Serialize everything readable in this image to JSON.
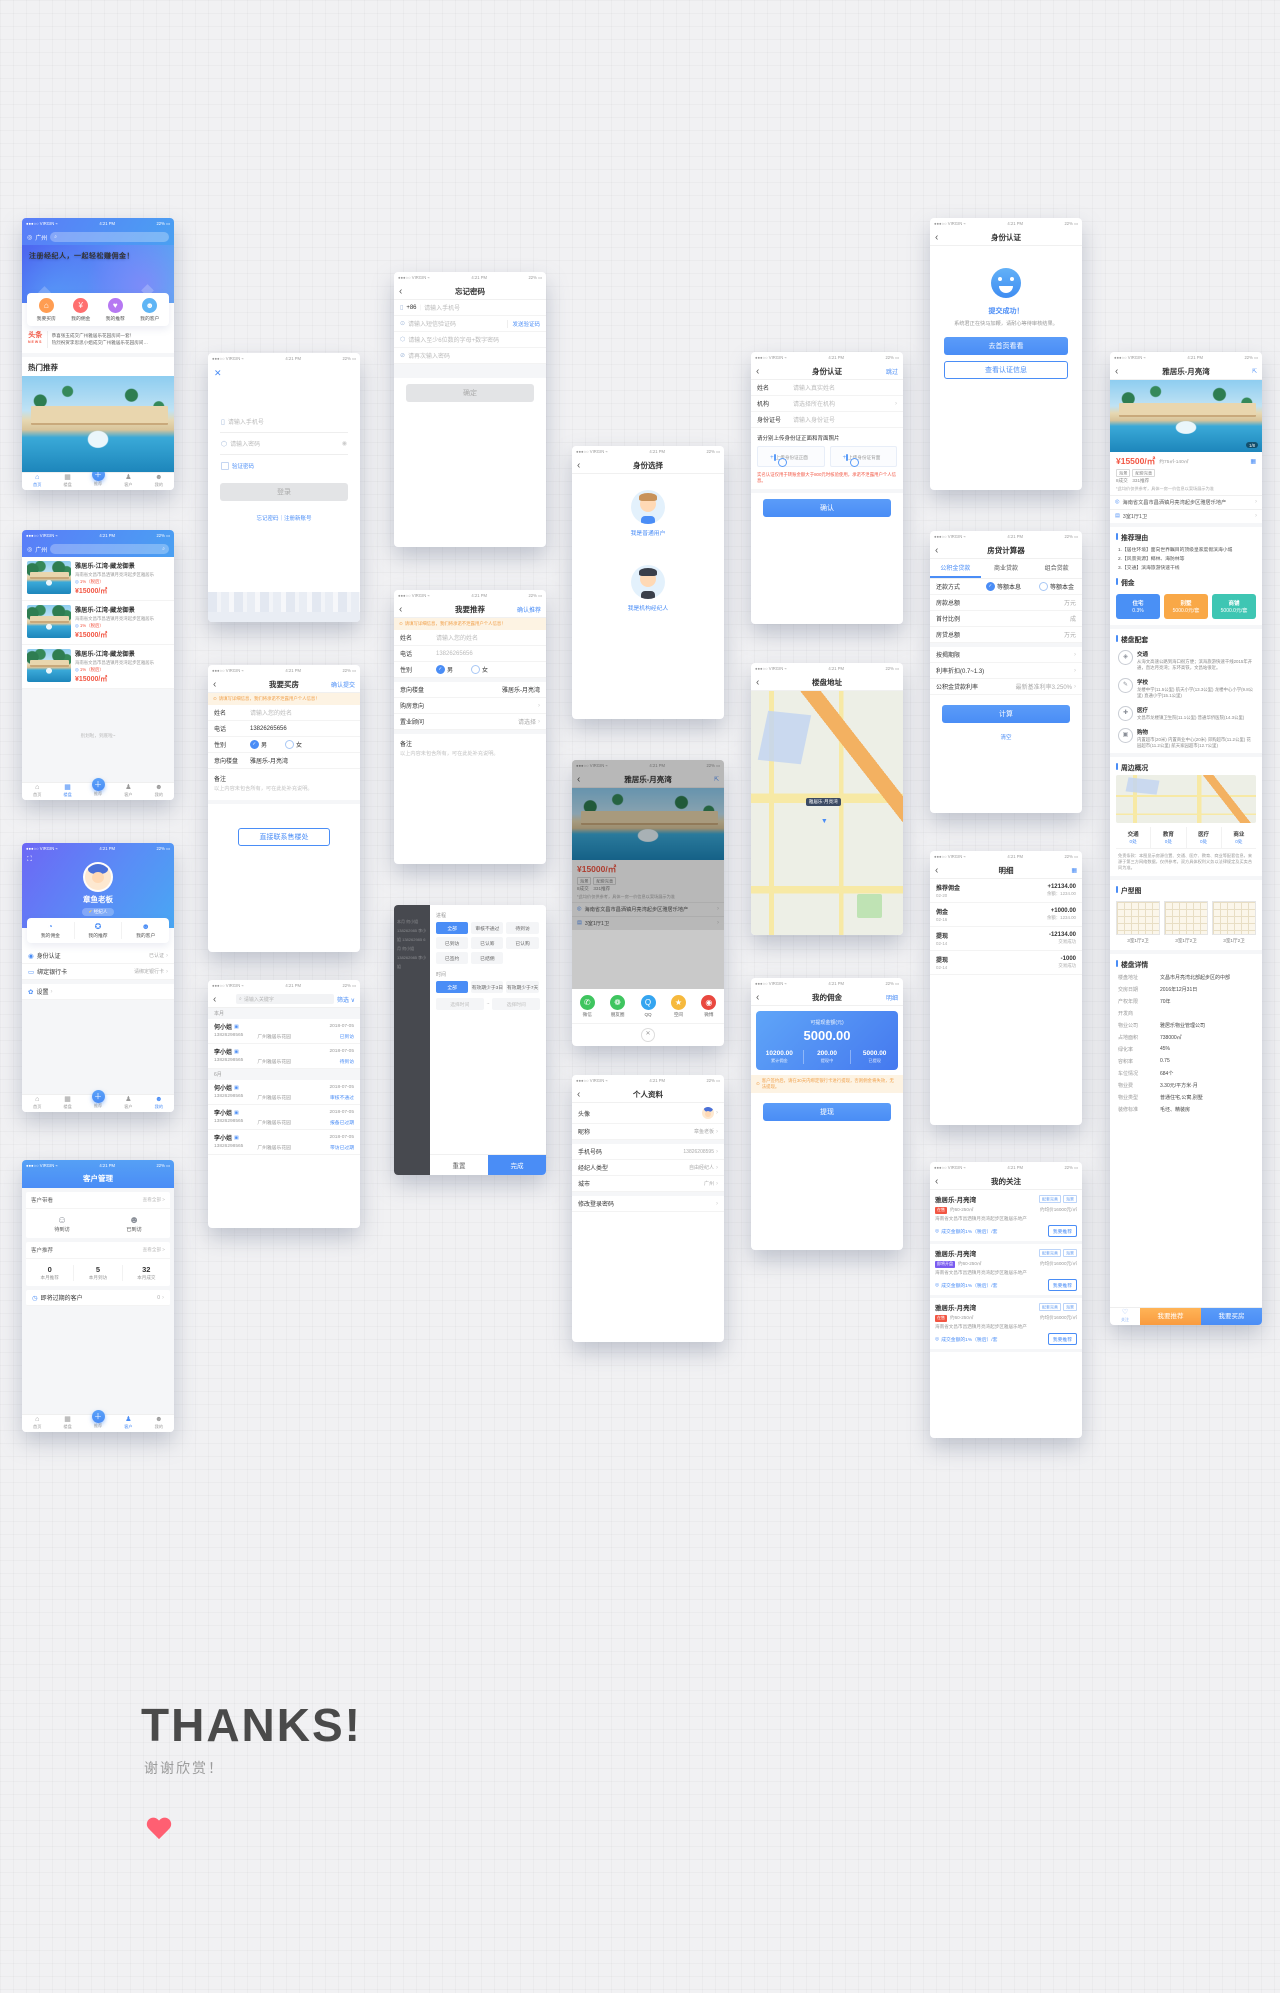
{
  "c": {
    "carrier": "●●●○○ VIRGIN ⌁",
    "time": "4:21 PM",
    "battery": "22% ▭"
  },
  "s": {
    "home": {
      "city": "广州",
      "banner": "注册经纪人，一起轻松赚佣金！",
      "cats": [
        {
          "label": "我要买房",
          "icon": "⌂",
          "color": "#ff9d52"
        },
        {
          "label": "我的佣金",
          "icon": "¥",
          "color": "#ff6f6f"
        },
        {
          "label": "我的推荐",
          "icon": "♥",
          "color": "#b678f2"
        },
        {
          "label": "我的客户",
          "icon": "☻",
          "color": "#5fb5f5"
        }
      ],
      "news_tag": "头条",
      "news_tag_en": "NEWS",
      "news": [
        "恭喜张玉成交广州雅居乐花园房间一套！",
        "热烈祝贺李思思小姐成交广州雅居乐花园房间…"
      ],
      "hot_title": "热门推荐",
      "tabs": [
        {
          "label": "首页",
          "icon": "⌂",
          "cls": "on"
        },
        {
          "label": "楼盘",
          "icon": "▦"
        },
        {
          "label": "推荐",
          "icon": "＋",
          "cls": "plus"
        },
        {
          "label": "客户",
          "icon": "♟"
        },
        {
          "label": "我的",
          "icon": "☻"
        }
      ]
    },
    "listings": {
      "city": "广州",
      "items": [
        {
          "title": "雅居乐-江湾-藏龙御景",
          "addr": "海南省文昌市昌洒镇月亮湾起步区雅居乐",
          "comm": "1%（税后）",
          "price": "¥15000/㎡"
        },
        {
          "title": "雅居乐-江湾-藏龙御景",
          "addr": "海南省文昌市昌洒镇月亮湾起步区雅居乐",
          "comm": "1%（税后）",
          "price": "¥15000/㎡"
        },
        {
          "title": "雅居乐-江湾-藏龙御景",
          "addr": "海南省文昌市昌洒镇月亮湾起步区雅居乐",
          "comm": "1%（税后）",
          "price": "¥15000/㎡"
        }
      ],
      "end": "别划啦，到底啦~",
      "tabs": [
        {
          "label": "首页",
          "icon": "⌂"
        },
        {
          "label": "楼盘",
          "icon": "▦",
          "cls": "on"
        },
        {
          "label": "推荐",
          "icon": "＋",
          "cls": "plus"
        },
        {
          "label": "客户",
          "icon": "♟"
        },
        {
          "label": "我的",
          "icon": "☻"
        }
      ]
    },
    "profile": {
      "name": "章鱼老板",
      "badge_check": "✔",
      "badge": "经纪人",
      "quick": [
        {
          "label": "我的佣金",
          "icon": "◔"
        },
        {
          "label": "我的推荐",
          "icon": "✪"
        },
        {
          "label": "我的客户",
          "icon": "☻"
        }
      ],
      "rows": [
        {
          "icon": "◉",
          "label": "身份认证",
          "value": "已认证"
        },
        {
          "icon": "▭",
          "label": "绑定银行卡",
          "value": "请绑定银行卡"
        }
      ],
      "settings": "设置",
      "settings_icon": "✿",
      "tabs": [
        {
          "label": "首页",
          "icon": "⌂"
        },
        {
          "label": "楼盘",
          "icon": "▦"
        },
        {
          "label": "推荐",
          "icon": "＋",
          "cls": "plus"
        },
        {
          "label": "客户",
          "icon": "♟"
        },
        {
          "label": "我的",
          "icon": "☻",
          "cls": "on"
        }
      ]
    },
    "customers": {
      "title": "客户管理",
      "more": "查看全部 >",
      "sec1": "客户带看",
      "visits": [
        {
          "label": "待到访",
          "icon": "☺"
        },
        {
          "label": "已到访",
          "icon": "☻"
        }
      ],
      "sec2": "客户推荐",
      "stats": [
        {
          "num": "0",
          "label": "本月推荐"
        },
        {
          "num": "5",
          "label": "本月到访"
        },
        {
          "num": "32",
          "label": "本月成交"
        }
      ],
      "expiring": "即将过期的客户",
      "expiring_count": "0",
      "tabs": [
        {
          "label": "首页",
          "icon": "⌂"
        },
        {
          "label": "楼盘",
          "icon": "▦"
        },
        {
          "label": "推荐",
          "icon": "＋",
          "cls": "plus"
        },
        {
          "label": "客户",
          "icon": "♟",
          "cls": "on"
        },
        {
          "label": "我的",
          "icon": "☻"
        }
      ]
    },
    "login": {
      "close": "✕",
      "phone_ph": "请输入手机号",
      "pwd_ph": "请输入密码",
      "remember": "验证密码",
      "submit": "登录",
      "link1": "忘记密码",
      "sep": "｜",
      "link2": "注册新账号"
    },
    "buyForm": {
      "title": "我要买房",
      "action": "确认提交",
      "warning": "请填写详细信息，我们将承诺不泄露用户个人信息！",
      "name_lbl": "姓名",
      "name_ph": "请输入您的姓名",
      "tel_lbl": "电话",
      "tel_val": "13826265656",
      "gender_lbl": "性别",
      "male": "男",
      "female": "女",
      "intent_lbl": "意向楼盘",
      "intent_val": "雅居乐-月亮湾",
      "note_lbl": "备注",
      "note_ph": "以上内容未包含所有，可在此处补充说明。",
      "contact_btn": "直接联系售楼处"
    },
    "clientList": {
      "search_ph": "请输入关键字",
      "filter": "筛选 ∨",
      "groups": [
        {
          "name": "本月",
          "entries": [
            {
              "name": "何小姐",
              "tel": "13826298565",
              "estate": "广州雅居乐花园",
              "date": "2018-07-05",
              "status": "已到访"
            },
            {
              "name": "李小姐",
              "tel": "13826298565",
              "estate": "广州雅居乐花园",
              "date": "2018-07-05",
              "status": "待到访"
            }
          ]
        },
        {
          "name": "6月",
          "entries": [
            {
              "name": "何小姐",
              "tel": "13826298565",
              "estate": "广州雅居乐花园",
              "date": "2018-07-05",
              "status": "审核不通过"
            },
            {
              "name": "李小姐",
              "tel": "13826298565",
              "estate": "广州雅居乐花园",
              "date": "2018-07-05",
              "status": "报备已过期"
            },
            {
              "name": "李小姐",
              "tel": "13826298565",
              "estate": "广州雅居乐花园",
              "date": "2018-07-05",
              "status": "带访已过期"
            }
          ]
        }
      ]
    },
    "forgotPwd": {
      "title": "忘记密码",
      "prefix": "+86",
      "phone_ph": "请输入手机号",
      "sms_ph": "请输入短信验证码",
      "send": "发送验证码",
      "pwd_ph": "请输入至少6位数的字母+数字密码",
      "pwd2_ph": "请再次输入密码",
      "submit": "确定"
    },
    "recommendForm": {
      "title": "我要推荐",
      "action": "确认推荐",
      "warning": "请填写详细信息，我们将承诺不泄露用户个人信息！",
      "name_lbl": "姓名",
      "name_ph": "请输入您的姓名",
      "tel_lbl": "电话",
      "tel_val": "13826265656",
      "gender_lbl": "性别",
      "male": "男",
      "female": "女",
      "intent_lbl": "意向楼盘",
      "intent_val": "雅居乐-月亮湾",
      "buy_lbl": "购房意向",
      "advisor_lbl": "置业顾问",
      "advisor_ph": "请选择",
      "note_lbl": "备注",
      "note_ph": "以上内容未包含所有，可在此处补充说明。"
    },
    "filter": {
      "ghost_lines": "本月  何小姐  138262985  李小姐  138262985  6月  何小姐  138262985  李小姐",
      "sec1": "进程",
      "process": [
        {
          "label": "全部",
          "cls": "sel"
        },
        {
          "label": "审核不通过"
        },
        {
          "label": "待到访"
        },
        {
          "label": "已到访"
        },
        {
          "label": "已认筹"
        },
        {
          "label": "已认购"
        },
        {
          "label": "已签约"
        },
        {
          "label": "已结佣"
        }
      ],
      "sec2": "时间",
      "time": [
        {
          "label": "全部",
          "cls": "sel"
        },
        {
          "label": "有效期少于3日"
        },
        {
          "label": "有效期少于7天"
        }
      ],
      "time_ph1": "选择时间",
      "tilde": "~",
      "time_ph2": "选择时间",
      "reset": "重置",
      "done": "完成"
    },
    "identityChoice": {
      "title": "身份选择",
      "opt1": "我是普通用户",
      "opt2": "我是机构经纪人"
    },
    "share": {
      "title": "雅居乐-月亮湾",
      "price": "¥15000/㎡",
      "tag1": "海景",
      "tag2": "配套完善",
      "deal": "8成交",
      "rec": "331推荐",
      "note": "*此均价仅供参考，具体一房一价信息以案场展示为准",
      "addr": "海南省文昌市昌洒镇月亮湾起步区雅居乐地产",
      "unit": "3室1厅1卫",
      "channels": [
        {
          "label": "微信",
          "icon": "✆",
          "color": "#3fc55f"
        },
        {
          "label": "朋友圈",
          "icon": "❁",
          "color": "#3fc55f"
        },
        {
          "label": "QQ",
          "icon": "Q",
          "color": "#35a5f0"
        },
        {
          "label": "空间",
          "icon": "★",
          "color": "#f6b93d"
        },
        {
          "label": "微博",
          "icon": "◉",
          "color": "#e9483f"
        }
      ]
    },
    "personalInfo": {
      "title": "个人资料",
      "avatar_lbl": "头像",
      "rows1": [
        {
          "label": "昵称",
          "value": "章鱼老板"
        }
      ],
      "rows2": [
        {
          "label": "手机号码",
          "value": "13826208595"
        },
        {
          "label": "经纪人类型",
          "value": "自由经纪人"
        },
        {
          "label": "城市",
          "value": "广州"
        }
      ],
      "rows3": [
        {
          "label": "修改登录密码",
          "value": ""
        }
      ]
    },
    "identityAuth": {
      "title": "身份认证",
      "skip": "跳过",
      "name_lbl": "姓名",
      "name_ph": "请输入真实姓名",
      "org_lbl": "机构",
      "org_ph": "请选择所在机构",
      "id_lbl": "身份证号",
      "id_ph": "请输入身份证号",
      "upload_hint": "请分别上传身份证正面和背面照片",
      "upload_front": "上传身份证正面",
      "upload_back": "上传身份证背面",
      "note": "实名认证仅用于转账金额大于800元时核验使用，承诺不泄露用户个人信息。",
      "confirm": "确认"
    },
    "mapScreen": {
      "title": "楼盘地址",
      "pin_label": "雅居乐·月亮湾",
      "pin": "▼"
    },
    "commission": {
      "title": "我的佣金",
      "action": "明细",
      "card_label": "可提现金额(元)",
      "amount": "5000.00",
      "stats": [
        {
          "num": "10200.00",
          "label": "累计佣金"
        },
        {
          "num": "200.00",
          "label": "提现中"
        },
        {
          "num": "5000.00",
          "label": "已提现"
        }
      ],
      "warning": "客户签约后，请在30天内绑定银行卡进行提现，否则佣金将失效，无法提现。",
      "withdraw": "提现"
    },
    "authSuccess": {
      "title": "身份认证",
      "result": "提交成功！",
      "desc": "系统君正在快马加鞭，请耐心等待审核结果。",
      "go_home": "去首页看看",
      "view_info": "查看认证信息"
    },
    "loanCalc": {
      "title": "房贷计算器",
      "tabs": [
        {
          "label": "公积金贷款",
          "cls": "on"
        },
        {
          "label": "商业贷款"
        },
        {
          "label": "组合贷款"
        }
      ],
      "repay_lbl": "还款方式",
      "repay1": "等额本息",
      "repay2": "等额本金",
      "rows": [
        {
          "label": "房款总额",
          "value": "万元"
        },
        {
          "label": "首付比例",
          "value": "成"
        },
        {
          "label": "房贷总额",
          "value": "万元"
        }
      ],
      "rows2": [
        {
          "label": "按揭期限",
          "value": ""
        },
        {
          "label": "利率折扣(0.7~1.3)",
          "value": ""
        },
        {
          "label": "公积金贷款利率",
          "value": "最新基准利率3.250%"
        }
      ],
      "calc": "计算",
      "clear": "清空"
    },
    "detailList": {
      "title": "明细",
      "rows": [
        {
          "name": "推荐佣金",
          "date": "02-20",
          "amount": "+12134.00",
          "note": "余额：1234.00"
        },
        {
          "name": "佣金",
          "date": "02-16",
          "amount": "+1000.00",
          "note": "余额：1234.00"
        },
        {
          "name": "提现",
          "date": "02-14",
          "amount": "-12134.00",
          "note": "交易成功"
        },
        {
          "name": "提现",
          "date": "02-14",
          "amount": "-1000",
          "note": "交易成功"
        }
      ]
    },
    "favorites": {
      "title": "我的关注",
      "items": [
        {
          "title": "雅居乐-月亮湾",
          "tag1": "配套完善",
          "tag2": "海景",
          "status": "在售",
          "status_color": "#f25643",
          "area": "约60-250㎡",
          "price": "约均价16000元/㎡",
          "addr": "海南省文昌市昌洒镇月亮湾起步区雅居乐地产",
          "comm": "成交金额的1%（税后）/套",
          "btn": "我要推荐"
        },
        {
          "title": "雅居乐-月亮湾",
          "tag1": "配套完善",
          "tag2": "海景",
          "status": "即将开盘",
          "status_color": "#7a5cf0",
          "area": "约60-250㎡",
          "price": "约均价16000元/㎡",
          "addr": "海南省文昌市昌洒镇月亮湾起步区雅居乐地产",
          "comm": "成交金额的1%（税后）/套",
          "btn": "我要推荐"
        },
        {
          "title": "雅居乐-月亮湾",
          "tag1": "配套完善",
          "tag2": "海景",
          "status": "在售",
          "status_color": "#f25643",
          "area": "约60-250㎡",
          "price": "约均价16000元/㎡",
          "addr": "海南省文昌市昌洒镇月亮湾起步区雅居乐地产",
          "comm": "成交金额的1%（税后）/套",
          "btn": "我要推荐"
        }
      ]
    },
    "propertyDetail": {
      "title": "雅居乐-月亮湾",
      "photo_badge": "1/8",
      "price": "¥15500/㎡",
      "range": "约75㎡-140㎡",
      "tag1": "海景",
      "tag2": "配套完善",
      "deal": "8成交",
      "rec": "331推荐",
      "note": "*此均价仅供参考，具体一房一价信息以案场展示为准",
      "addr": "海南省文昌市昌洒镇月亮湾起步区雅居乐地产",
      "unit": "3室1厅1卫",
      "sec_reason": "推荐理由",
      "reasons": [
        {
          "text": "1.【居住环境】面向世界瞩目的顶级皇家度假滨海小城"
        },
        {
          "text": "2.【风景资源】椰林、海防林等"
        },
        {
          "text": "3.【交通】滨海旅游快速干线"
        }
      ],
      "sec_comm": "佣金",
      "comm_cards": [
        {
          "name": "住宅",
          "value": "0.3%",
          "color": "#4a90f5"
        },
        {
          "name": "别墅",
          "value": "5000.0元/套",
          "color": "#f9a847"
        },
        {
          "name": "商铺",
          "value": "5000.0元/套",
          "color": "#3ec6b3"
        }
      ],
      "sec_fac": "楼盘配套",
      "facilities": [
        {
          "name": "交通",
          "icon": "◈",
          "text": "从海文高速公路到海口很方便；滨海旅游快速干线2015年开通，直达月亮湾；东环高铁，文昌站很近。"
        },
        {
          "name": "学校",
          "icon": "✎",
          "text": "龙楼中学(11.5公里) 航天小学(13.3公里) 龙楼中心小学(9.8公里) 直通小学(15.1公里)"
        },
        {
          "name": "医疗",
          "icon": "✚",
          "text": "文昌市龙楼镇卫生院(11.1公里) 普通华侨医院(14.3公里)"
        },
        {
          "name": "购物",
          "icon": "▣",
          "text": "内置超市(20米) 内置商业中心(20米) 郊购超市(11.2公里) 花园超市(11.2公里) 航天家园超市(12.7公里)"
        }
      ],
      "sec_around": "周边概况",
      "around_tabs": [
        {
          "name": "交通",
          "count": "0处"
        },
        {
          "name": "教育",
          "count": "0处"
        },
        {
          "name": "医疗",
          "count": "0处"
        },
        {
          "name": "商业",
          "count": "0处"
        }
      ],
      "disclaimer": "免责条款：本图显示房源位置、交通、医疗、教育、商业等配套信息，来源于第三方网络数据，仅供参考。双方具体权利义务以法律规定及买卖合同为准。",
      "sec_plans": "户型图",
      "plans": [
        {
          "caption": "3室1厅2卫"
        },
        {
          "caption": "3室1厅2卫"
        },
        {
          "caption": "3室1厅2卫"
        }
      ],
      "sec_detail": "楼盘详情",
      "details": [
        {
          "label": "楼盘地址",
          "value": "文昌市月亮湾北部起步区的中部"
        },
        {
          "label": "交房日期",
          "value": "2016年12月31日"
        },
        {
          "label": "产权年限",
          "value": "70年"
        },
        {
          "label": "开发商",
          "value": ""
        },
        {
          "label": "物业公司",
          "value": "雅居乐物业管理公司"
        },
        {
          "label": "占地面积",
          "value": "738000㎡"
        },
        {
          "label": "绿化率",
          "value": "45%"
        },
        {
          "label": "容积率",
          "value": "0.75"
        },
        {
          "label": "车位情况",
          "value": "684个"
        },
        {
          "label": "物业费",
          "value": "3.30元/平方米·月"
        },
        {
          "label": "物业类型",
          "value": "普通住宅,公寓,别墅"
        },
        {
          "label": "装修标准",
          "value": "毛坯、精装房"
        }
      ],
      "fav": "关注",
      "fav_icon": "♡",
      "btn_rec": "我要推荐",
      "btn_buy": "我要买房"
    }
  },
  "f": {
    "thanks": "THANKS!",
    "sub": "谢谢欣赏！"
  }
}
